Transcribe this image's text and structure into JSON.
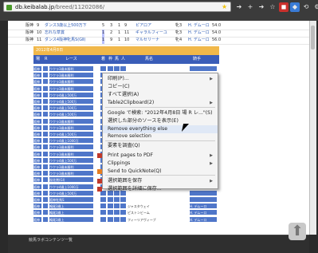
{
  "browser": {
    "url_domain": "db.keibalab.jp",
    "url_path": "/breed/11202086/",
    "toolbar_icons": [
      "arrow-icon",
      "plus-icon",
      "extension-red-icon",
      "extension-blue-icon",
      "wrench-icon",
      "menu-icon"
    ]
  },
  "top_table": {
    "rows": [
      {
        "place": "阪神",
        "num": "9",
        "race": "ダンス3歳以上500万下",
        "a": "5",
        "b": "3",
        "c": "1",
        "d": "9",
        "horse": "ピアロア",
        "tag": "牝3",
        "jockey": "H. デムーロ",
        "wt": "54.0"
      },
      {
        "place": "阪神",
        "num": "10",
        "race": "忘れな草賞",
        "a": "1",
        "b": "2",
        "c": "1",
        "d": "11",
        "horse": "ギャラルフィーユ",
        "tag": "牝3",
        "jockey": "H. デムーロ",
        "wt": "54.0"
      },
      {
        "place": "阪神",
        "num": "11",
        "race": "ダンス4阪神牝馬S(GⅡ)",
        "a": "1",
        "b": "9",
        "c": "1",
        "d": "10",
        "horse": "マルセリーナ",
        "tag": "牝4",
        "jockey": "H. デムーロ",
        "wt": "56.0"
      }
    ]
  },
  "banner": "2012年4月8日",
  "header_cols": [
    "場",
    "R",
    "レース",
    "着",
    "枠",
    "馬",
    "人",
    "馬名",
    "騎手"
  ],
  "grid_rows": [
    {
      "place": "阪神",
      "race": "ウクラ3歳未勝利"
    },
    {
      "place": "阪神",
      "race": "ウクラ3歳未勝利"
    },
    {
      "place": "阪神",
      "race": "ウクラ3歳未勝利"
    },
    {
      "place": "阪神",
      "race": "ウクラ3歳未勝利"
    },
    {
      "place": "阪神",
      "race": "ウクラ4歳上500万"
    },
    {
      "place": "阪神",
      "race": "ウクラ4歳上500万"
    },
    {
      "place": "阪神",
      "race": "ウクラ4歳上500万"
    },
    {
      "place": "阪神",
      "race": "ウクラ4歳上500万"
    },
    {
      "place": "阪神",
      "race": "ウクラ3歳未勝利"
    },
    {
      "place": "阪神",
      "race": "ウクラ3歳未勝利"
    },
    {
      "place": "阪神",
      "race": "ウクラ4歳上500万"
    },
    {
      "place": "阪神",
      "race": "ウクラ4歳上1000万"
    },
    {
      "place": "阪神",
      "race": "ウクラ3歳未勝利"
    },
    {
      "place": "阪神",
      "race": "ウクラ3歳未勝利"
    },
    {
      "place": "阪神",
      "race": "ウクラ4歳上500万"
    },
    {
      "place": "阪神",
      "race": "ウクラ3歳未勝利"
    },
    {
      "place": "阪神",
      "race": "ウクラ3歳未勝利"
    },
    {
      "place": "阪神",
      "race": "桜花賞(GⅠ)"
    },
    {
      "place": "阪神",
      "race": "ウクラ4歳上1000万"
    },
    {
      "place": "阪神",
      "race": "ウクラ4歳上500万"
    },
    {
      "place": "阪神",
      "race": "阪神牝馬S"
    },
    {
      "place": "阪神",
      "race": "鳴尾3歳上"
    },
    {
      "place": "阪神",
      "race": "鳴尾3歳上"
    },
    {
      "place": "阪神",
      "race": "鳴尾3歳上"
    }
  ],
  "grid_extra": {
    "row22_horse": "ジャスタウェイ",
    "row23_horse": "ピストンビーム",
    "row24_horse": "フィーリアヴィーブ",
    "row22_jockey": "H. デムーロ",
    "row23_jockey": "H. デムーロ",
    "row24_jockey": "H. デムーロ"
  },
  "context_menu": {
    "items": [
      {
        "label": "印刷(P)...",
        "submenu": true
      },
      {
        "label": "コピー(C)",
        "submenu": false
      },
      {
        "label": "すべて選択(A)",
        "submenu": false
      },
      {
        "label": "Table2Clipboard(2)",
        "submenu": true
      },
      {
        "label": "Google で検索: \"2012年4月8日 場 R レ...\"(S)",
        "submenu": false
      },
      {
        "label": "選択した部分のソースを表示(E)",
        "submenu": false
      },
      {
        "label": "Remove everything else",
        "submenu": false
      },
      {
        "label": "Remove selection",
        "submenu": false
      },
      {
        "label": "要素を調査(Q)",
        "submenu": false
      },
      {
        "label": "Print pages to PDF",
        "submenu": true
      },
      {
        "label": "Clippings",
        "submenu": true
      },
      {
        "label": "Send to QuickNote(Q)",
        "submenu": false
      },
      {
        "label": "選択範囲を保存",
        "submenu": true
      },
      {
        "label": "選択範囲を詳細に保存...",
        "submenu": false
      }
    ]
  },
  "footer": {
    "text": "競馬ラボコンテンツ一覧"
  }
}
